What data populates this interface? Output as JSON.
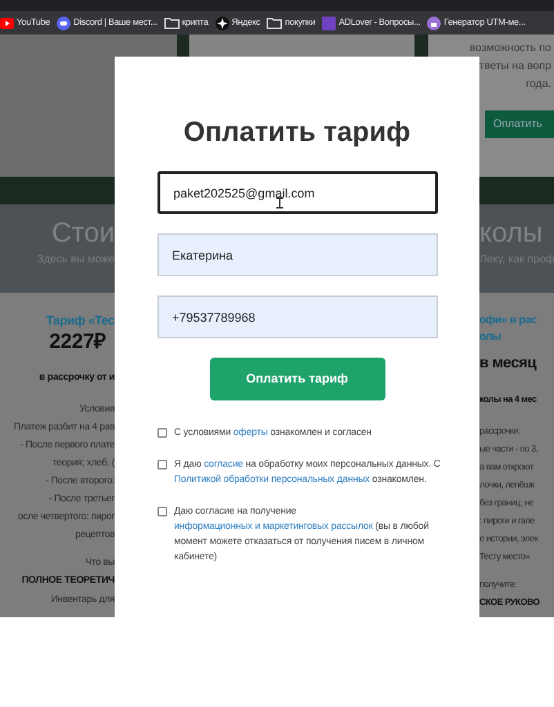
{
  "bookmarks": [
    {
      "kind": "youtube",
      "label": "YouTube"
    },
    {
      "kind": "discord",
      "label": "Discord | Ваше мест..."
    },
    {
      "kind": "folder",
      "label": "крипта"
    },
    {
      "kind": "yandex",
      "label": "Яндекс"
    },
    {
      "kind": "folder",
      "label": "покупки"
    },
    {
      "kind": "adlover",
      "label": "ADLover - Вопросы..."
    },
    {
      "kind": "utm",
      "label": "Генератор UTM-ме..."
    }
  ],
  "background_page": {
    "card_lines": [
      "возможность по",
      "тветы на вопр",
      "года."
    ],
    "card_button": "Оплатить",
    "section_title_left": "Стои",
    "section_title_right": "колы",
    "section_subtitle_left": "Здесь вы може",
    "section_subtitle_right": "Леку, как проф",
    "left_tariff": {
      "heading": "Тариф «Тес",
      "price": "2227₽",
      "installment": "в рассрочку от и",
      "lines": [
        "Условия",
        "Платеж разбит на 4 рав",
        "- После первого плате",
        "теория; хлеб, (",
        "- После второго:",
        "- После третьег",
        "осле четвертого: пирог",
        "рецептов"
      ],
      "what": "Что вы",
      "bold_line": "ПОЛНОЕ ТЕОРЕТИЧ",
      "last_line": "Инвентарь для"
    },
    "right_tariff": {
      "heading": [
        "офи» в рас",
        "олы"
      ],
      "price": "в месяц",
      "installment": "колы на 4 мес",
      "lines": [
        "рассрочки:",
        "ые части - по 3,",
        "а вам откроют",
        "лочки, лепёшк",
        "без границ; не",
        ": пироги и гале",
        "е истории, элек",
        "Тесту место»"
      ],
      "what": "получите:",
      "bold_line": "СКОЕ РУКОВО"
    }
  },
  "modal": {
    "title": "Оплатить тариф",
    "fields": [
      {
        "value": "paket202525@gmail.com",
        "focused": true,
        "autofilled": false
      },
      {
        "value": "Екатерина",
        "focused": false,
        "autofilled": true
      },
      {
        "value": "+79537789968",
        "focused": false,
        "autofilled": true
      }
    ],
    "submit": "Оплатить тариф",
    "consents": [
      {
        "checked": false,
        "parts": [
          {
            "text": "С условиями ",
            "kind": "text"
          },
          {
            "text": "оферты",
            "kind": "link"
          },
          {
            "text": " ознакомлен и согласен",
            "kind": "text"
          }
        ]
      },
      {
        "checked": false,
        "parts": [
          {
            "text": "Я даю ",
            "kind": "text"
          },
          {
            "text": "согласие",
            "kind": "link"
          },
          {
            "text": " на обработку моих персональных данных. С ",
            "kind": "text"
          },
          {
            "text": "Политикой обработки персональных данных",
            "kind": "link"
          },
          {
            "text": " ознакомлен.",
            "kind": "text"
          }
        ]
      },
      {
        "checked": false,
        "parts": [
          {
            "text": "Даю согласие на получение ",
            "kind": "text"
          },
          {
            "text": "информационных и маркетинговых рассылок",
            "kind": "link"
          },
          {
            "text": " (вы в любой момент можете отказаться от получения писем в личном кабинете)",
            "kind": "text"
          }
        ]
      }
    ]
  }
}
